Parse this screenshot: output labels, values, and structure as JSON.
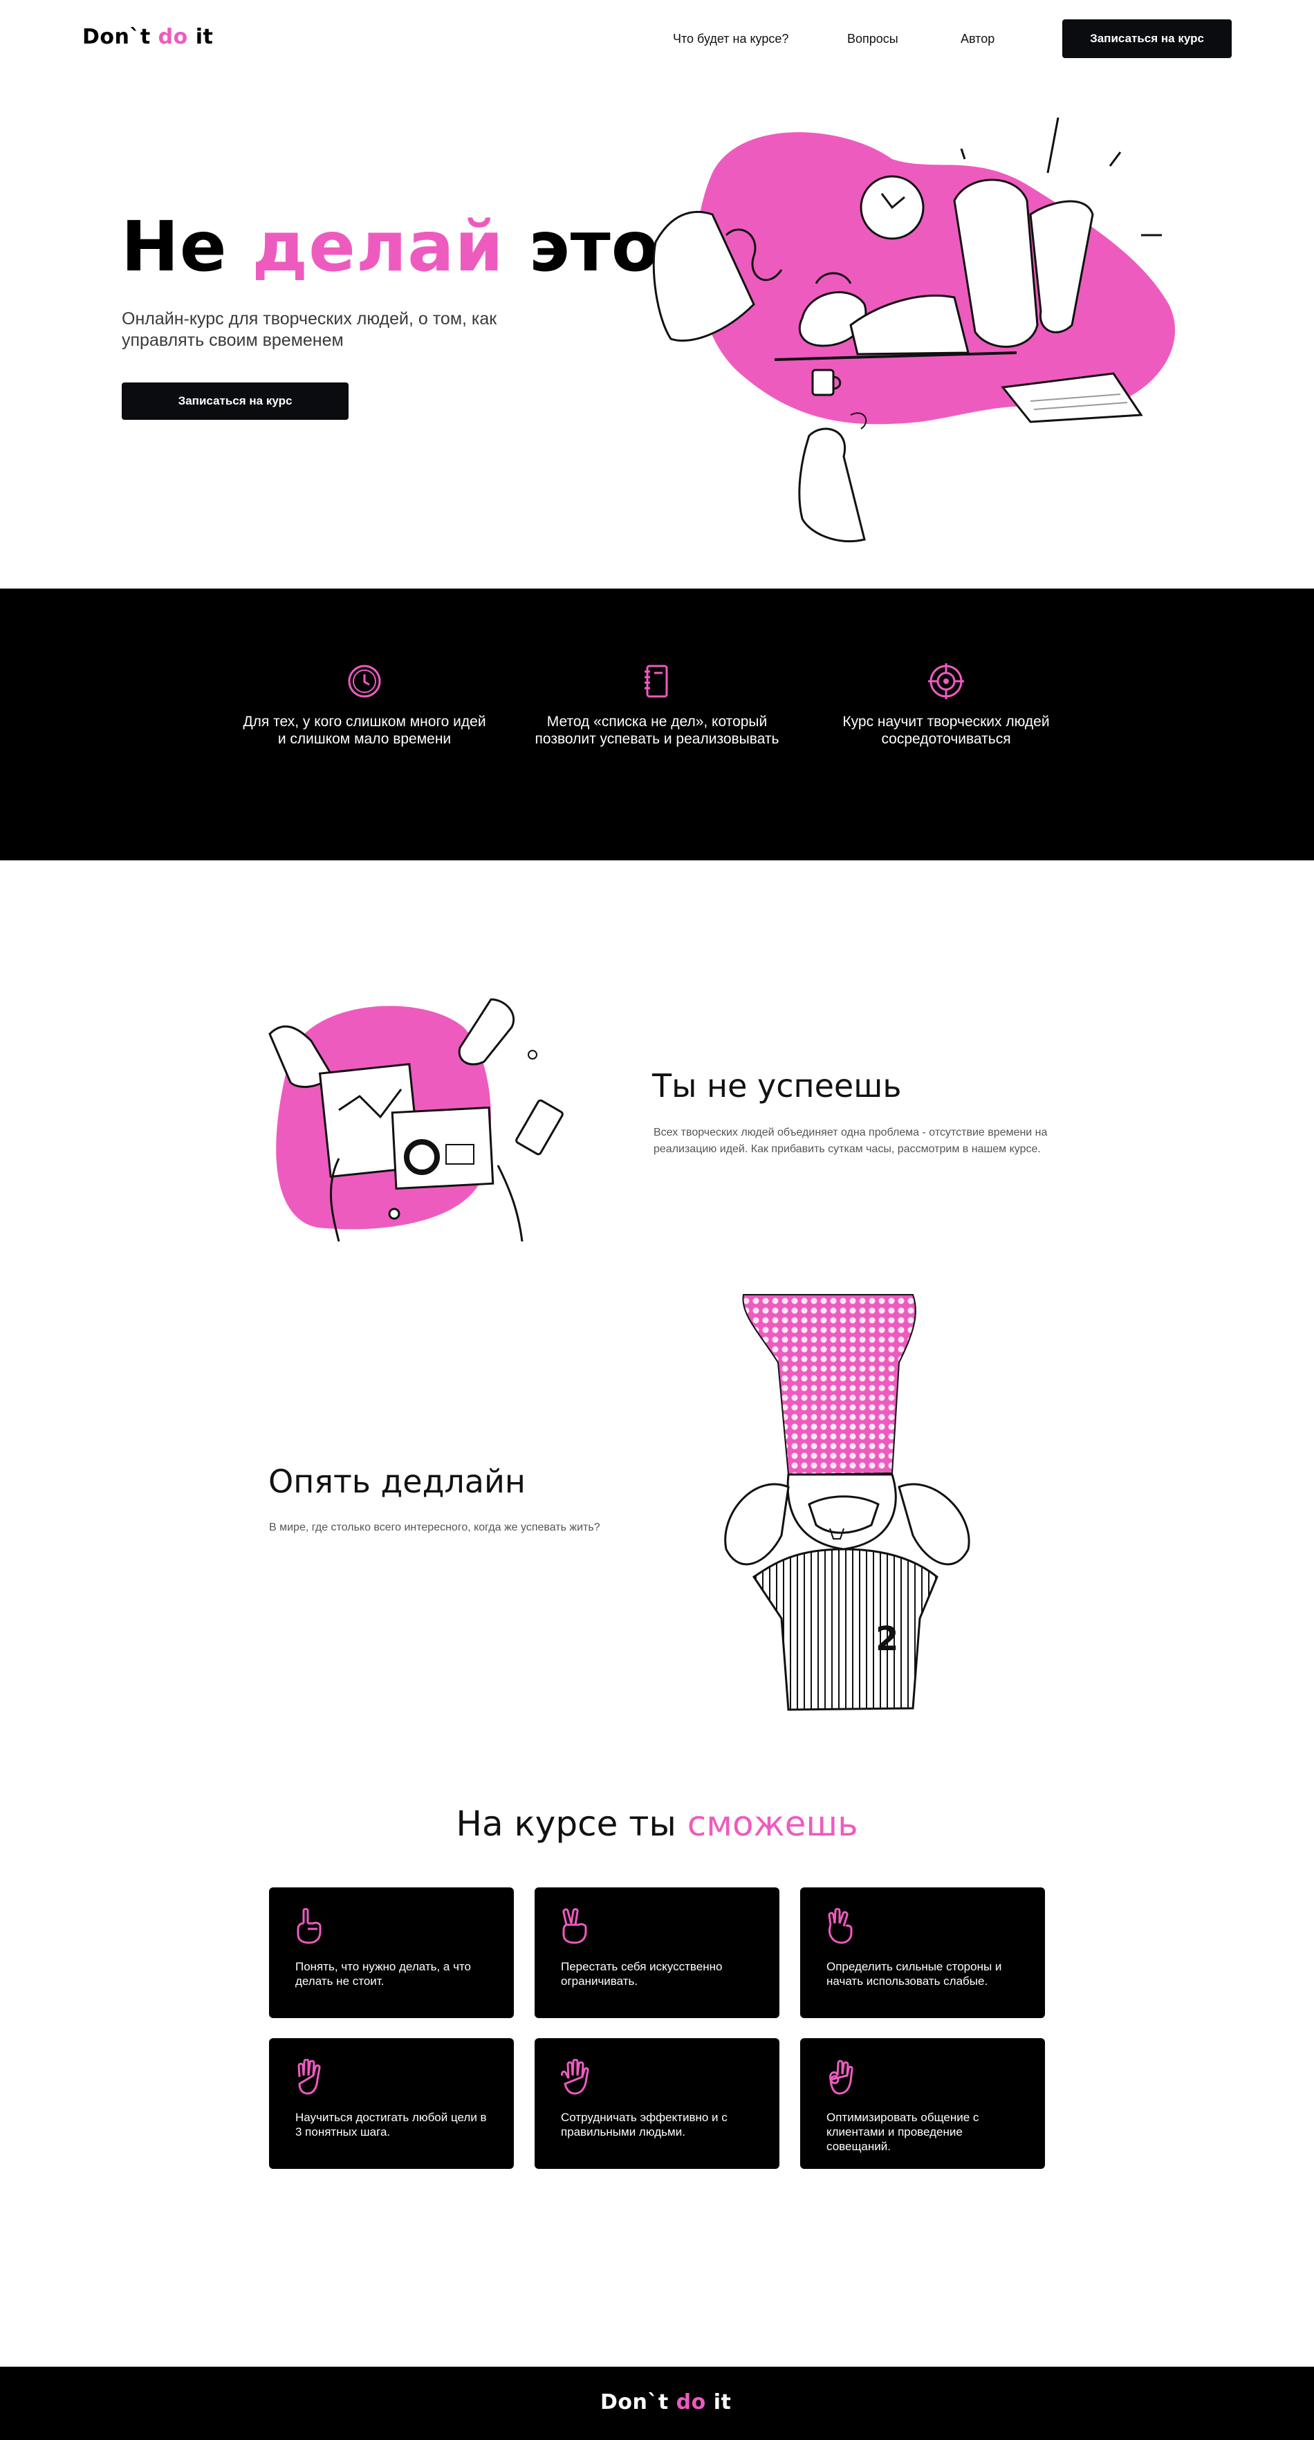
{
  "header": {
    "logo": {
      "part1": "Don`t ",
      "part2": "do",
      "part3": " it"
    },
    "nav": [
      {
        "label": "Что будет на курсе?"
      },
      {
        "label": "Вопросы"
      },
      {
        "label": "Автор"
      }
    ],
    "cta": "Записаться на курс"
  },
  "hero": {
    "title_part1": "Не ",
    "title_accent": "делай",
    "title_part2": " это",
    "subtitle": "Онлайн-курс для творческих людей, о том, как управлять своим временем",
    "cta": "Записаться на курс"
  },
  "features": [
    {
      "icon": "clock-icon",
      "text": "Для тех, у кого слишком много идей и слишком мало времени"
    },
    {
      "icon": "notebook-icon",
      "text": "Метод «списка не дел», который позволит успевать и реализовывать"
    },
    {
      "icon": "target-icon",
      "text": "Курс научит творческих людей сосредоточиваться"
    }
  ],
  "section1": {
    "title": "Ты не успеешь",
    "text": "Всех творческих людей объединяет одна проблема - отсутствие времени на реализацию идей. Как прибавить суткам часы, рассмотрим в нашем курсе."
  },
  "section2": {
    "title": "Опять дедлайн",
    "text": "В мире, где столько всего интересного, когда же успевать жить?",
    "jersey_number": "2"
  },
  "skills": {
    "title_part1": "На курсе ты ",
    "title_accent": "сможешь",
    "cards": [
      {
        "icon": "hand-one-finger-icon",
        "text": "Понять, что нужно делать, а что делать не стоит."
      },
      {
        "icon": "hand-two-fingers-icon",
        "text": "Перестать себя искусственно ограничивать."
      },
      {
        "icon": "hand-three-fingers-icon",
        "text": "Определить сильные стороны и начать использовать слабые."
      },
      {
        "icon": "hand-four-fingers-icon",
        "text": "Научиться достигать любой цели в 3 понятных шага."
      },
      {
        "icon": "hand-five-fingers-icon",
        "text": "Сотрудничать эффективно и с правильными людьми."
      },
      {
        "icon": "hand-ok-icon",
        "text": "Оптимизировать общение с клиентами и проведение совещаний."
      }
    ]
  },
  "footer": {
    "logo": {
      "part1": "Don`t ",
      "part2": "do",
      "part3": " it"
    }
  },
  "colors": {
    "accent": "#ee5bbf",
    "dark": "#000000",
    "button": "#0b0c10"
  }
}
